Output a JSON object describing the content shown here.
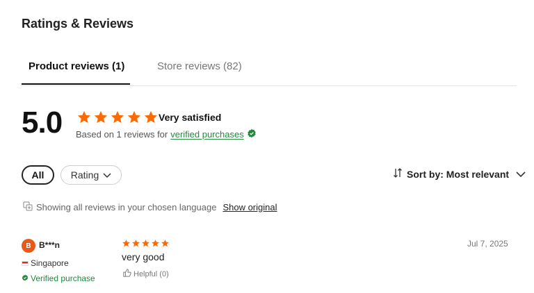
{
  "header": {
    "title": "Ratings & Reviews"
  },
  "tabs": [
    {
      "label": "Product reviews (1)",
      "active": true
    },
    {
      "label": "Store reviews (82)",
      "active": false
    }
  ],
  "summary": {
    "score": "5.0",
    "rating_stars": 5,
    "satisfaction": "Very satisfied",
    "based_on": "Based on 1 reviews for",
    "verified_link": "verified purchases"
  },
  "filters": {
    "all_label": "All",
    "rating_label": "Rating",
    "sort_label": "Sort by: Most relevant"
  },
  "language_notice": {
    "text": "Showing all reviews in your chosen language",
    "link": "Show original"
  },
  "reviews": [
    {
      "avatar_letter": "B",
      "name": "B***n",
      "country": "Singapore",
      "verified": "Verified purchase",
      "stars": 5,
      "text": "very good",
      "helpful": "Helpful (0)",
      "date": "Jul 7, 2025"
    }
  ],
  "colors": {
    "star": "#ff6a00",
    "verified_green": "#1e8a3a",
    "avatar": "#e65a1a"
  }
}
